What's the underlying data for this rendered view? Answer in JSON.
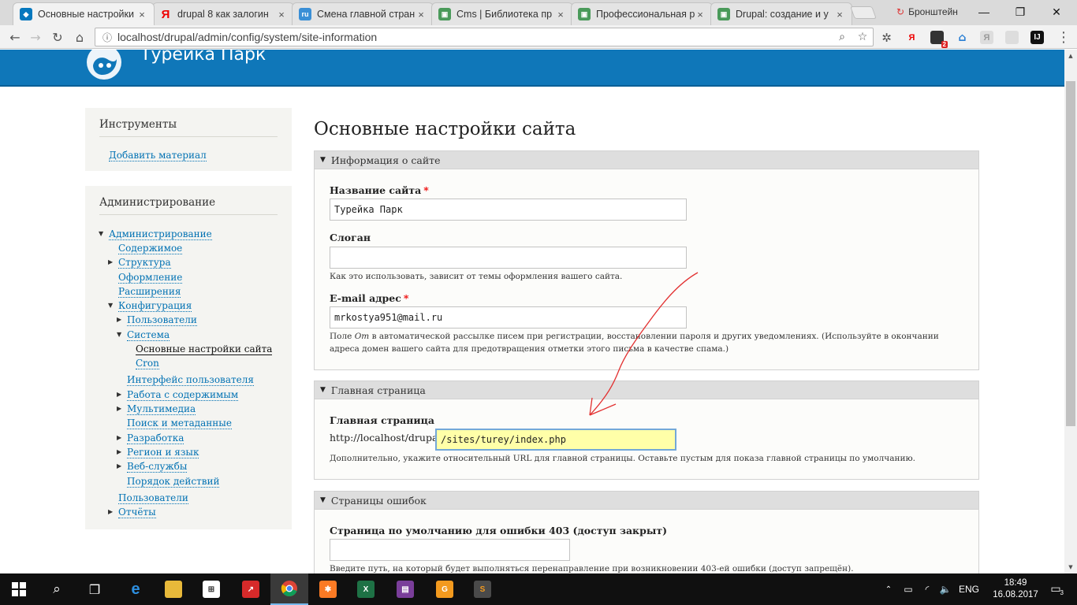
{
  "browser": {
    "tabs": [
      {
        "title": "Основные настройки",
        "favicon": "drupal-icon",
        "color": "#0678be",
        "active": true
      },
      {
        "title": "drupal 8 как залогин",
        "favicon": "yandex-icon",
        "color": "#ff0000"
      },
      {
        "title": "Смена главной стран",
        "favicon": "drupal-ru-icon",
        "color": "#3a8fd6"
      },
      {
        "title": "Cms | Библиотека пр",
        "favicon": "site-icon",
        "color": "#4a9a5a"
      },
      {
        "title": "Профессиональная р",
        "favicon": "site-icon",
        "color": "#4a9a5a"
      },
      {
        "title": "Drupal: создание и у",
        "favicon": "site-icon",
        "color": "#4a9a5a"
      }
    ],
    "profile_name": "Бронштейн",
    "url": "localhost/drupal/admin/config/system/site-information",
    "ext_badge": "2"
  },
  "site": {
    "name": "Турейка Парк"
  },
  "sidebar": {
    "tools": {
      "title": "Инструменты",
      "add_content": "Добавить материал"
    },
    "admin": {
      "title": "Администрирование",
      "items": [
        {
          "label": "Администрирование",
          "arrow": "down",
          "level": 0
        },
        {
          "label": "Содержимое",
          "arrow": "",
          "level": 1
        },
        {
          "label": "Структура",
          "arrow": "right",
          "level": 1
        },
        {
          "label": "Оформление",
          "arrow": "",
          "level": 1
        },
        {
          "label": "Расширения",
          "arrow": "",
          "level": 1
        },
        {
          "label": "Конфигурация",
          "arrow": "down",
          "level": 1
        },
        {
          "label": "Пользователи",
          "arrow": "right",
          "level": 2
        },
        {
          "label": "Система",
          "arrow": "down",
          "level": 2
        },
        {
          "label": "Основные настройки сайта",
          "arrow": "",
          "level": 3,
          "current": true
        },
        {
          "label": "Cron",
          "arrow": "",
          "level": 3
        },
        {
          "label": "Интерфейс пользователя",
          "arrow": "",
          "level": 2
        },
        {
          "label": "Работа с содержимым",
          "arrow": "right",
          "level": 2
        },
        {
          "label": "Мультимедиа",
          "arrow": "right",
          "level": 2
        },
        {
          "label": "Поиск и метаданные",
          "arrow": "",
          "level": 2
        },
        {
          "label": "Разработка",
          "arrow": "right",
          "level": 2
        },
        {
          "label": "Регион и язык",
          "arrow": "right",
          "level": 2
        },
        {
          "label": "Веб-службы",
          "arrow": "right",
          "level": 2
        },
        {
          "label": "Порядок действий",
          "arrow": "",
          "level": 2
        },
        {
          "label": "Пользователи",
          "arrow": "",
          "level": 1
        },
        {
          "label": "Отчёты",
          "arrow": "right",
          "level": 1
        }
      ]
    }
  },
  "page": {
    "title": "Основные настройки сайта",
    "site_info": {
      "legend": "Информация о сайте",
      "name_label": "Название сайта",
      "name_value": "Турейка Парк",
      "slogan_label": "Слоган",
      "slogan_value": "",
      "slogan_desc": "Как это использовать, зависит от темы оформления вашего сайта.",
      "email_label": "E-mail адрес",
      "email_value": "mrkostya951@mail.ru",
      "email_desc_1": "Поле ",
      "email_desc_em": "От",
      "email_desc_2": " в автоматической рассылке писем при регистрации, восстановлении пароля и других уведомлениях. (Используйте в окончании адреса домен вашего сайта для предотвращения отметки этого письма в качестве спама.)",
      "required_mark": "*"
    },
    "front_page": {
      "legend": "Главная страница",
      "label": "Главная страница",
      "prefix": "http://localhost/drupal",
      "value": "/sites/turey/index.php",
      "desc": "Дополнительно, укажите относительный URL для главной страницы. Оставьте пустым для показа главной страницы по умолчанию."
    },
    "error_pages": {
      "legend": "Страницы ошибок",
      "label_403": "Страница по умолчанию для ошибки 403 (доступ закрыт)",
      "value_403": "",
      "desc_403": "Введите путь, на который будет выполняться перенаправление при возникновении 403-ей ошибки (доступ запрещён)."
    }
  },
  "taskbar": {
    "lang": "ENG",
    "time": "18:49",
    "date": "16.08.2017",
    "notif_count": "3"
  },
  "colors": {
    "header": "#0f77b9",
    "link": "#0071b3",
    "required": "#e00000",
    "focus_bg": "#ffffa8",
    "annotation": "#e23030"
  }
}
